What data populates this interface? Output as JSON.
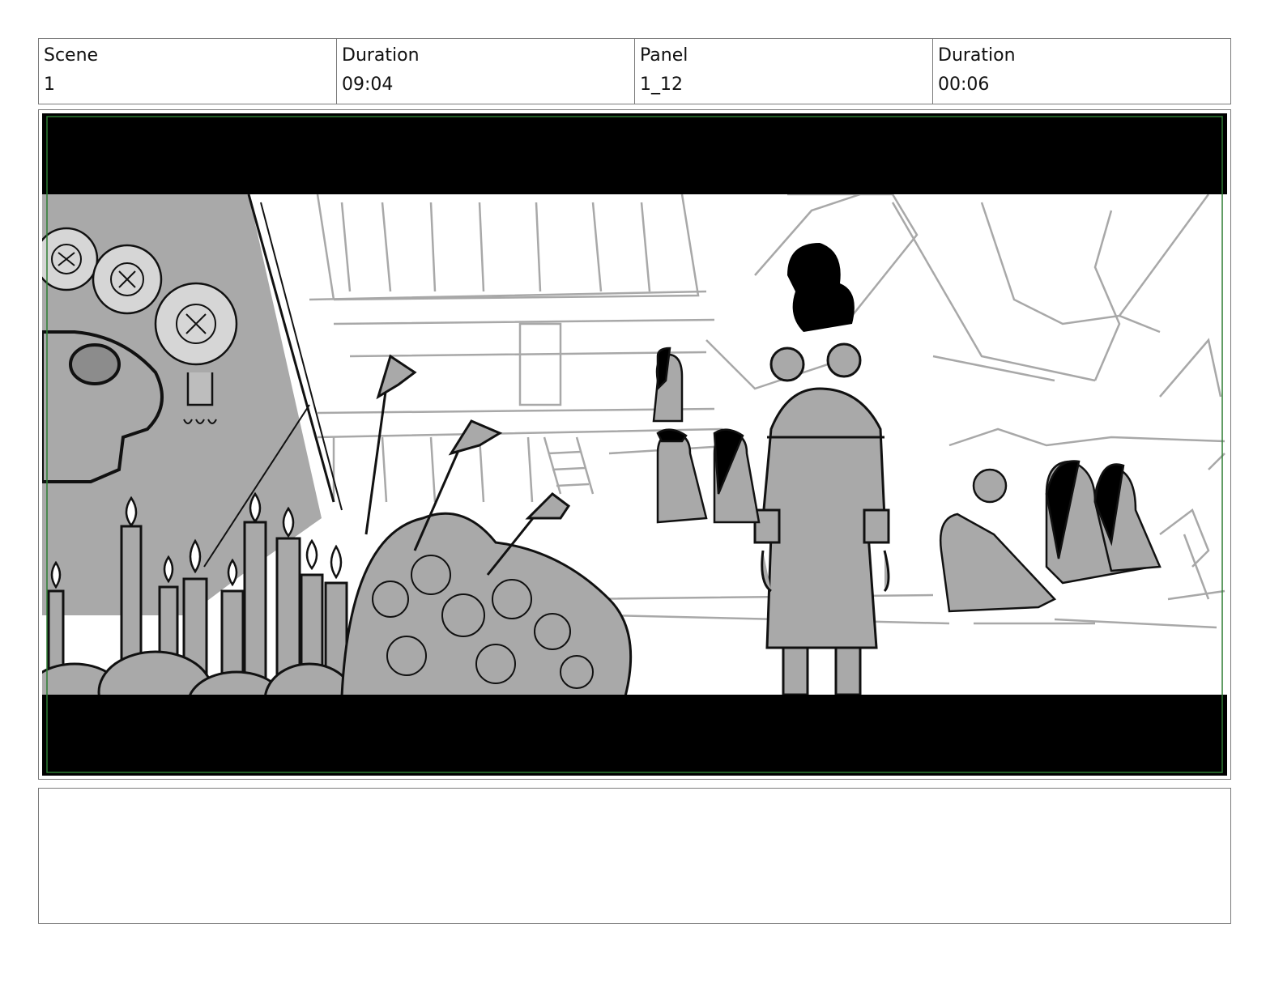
{
  "header": {
    "scene": {
      "label": "Scene",
      "value": "1"
    },
    "scene_duration": {
      "label": "Duration",
      "value": "09:04"
    },
    "panel": {
      "label": "Panel",
      "value": "1_12"
    },
    "panel_duration": {
      "label": "Duration",
      "value": "00:06"
    }
  },
  "panel_image": {
    "description_icon": "storyboard-sketch",
    "colors": {
      "letterbox": "#000000",
      "safe_frame": "#2e7d32",
      "tone": "#a9a9a9"
    }
  },
  "notes": {
    "text": ""
  }
}
